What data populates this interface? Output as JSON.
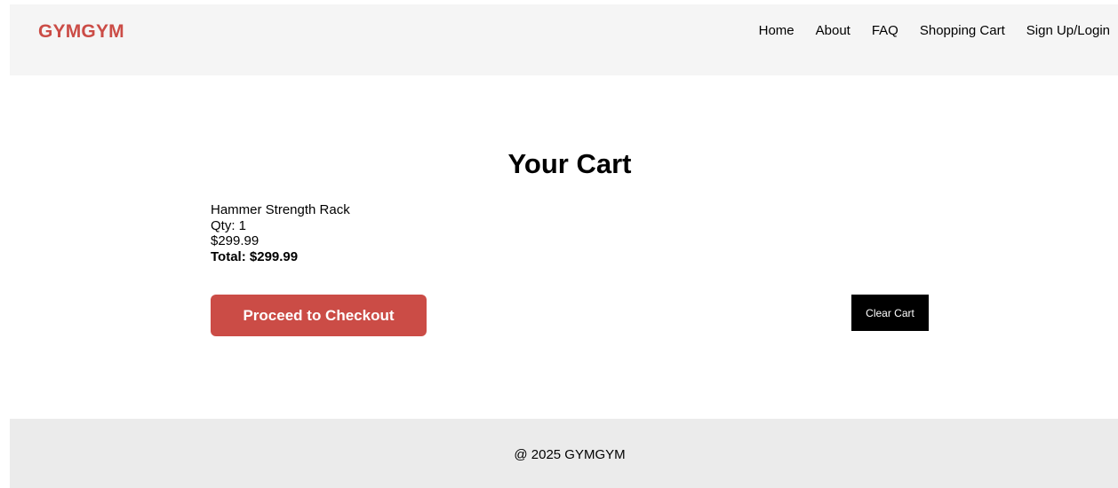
{
  "header": {
    "logo": "GYMGYM",
    "nav": [
      "Home",
      "About",
      "FAQ",
      "Shopping Cart",
      "Sign Up/Login"
    ]
  },
  "main": {
    "title": "Your Cart",
    "item": {
      "name": "Hammer Strength Rack",
      "qty": "Qty: 1",
      "price": "$299.99"
    },
    "total": "Total: $299.99",
    "checkout_label": "Proceed to Checkout",
    "clear_label": "Clear Cart"
  },
  "footer": {
    "text": "@ 2025 GYMGYM"
  },
  "colors": {
    "brand": "#cb4c46",
    "header_bg": "#f5f5f5",
    "footer_bg": "#ebebeb",
    "clear_button_bg": "#000000"
  }
}
